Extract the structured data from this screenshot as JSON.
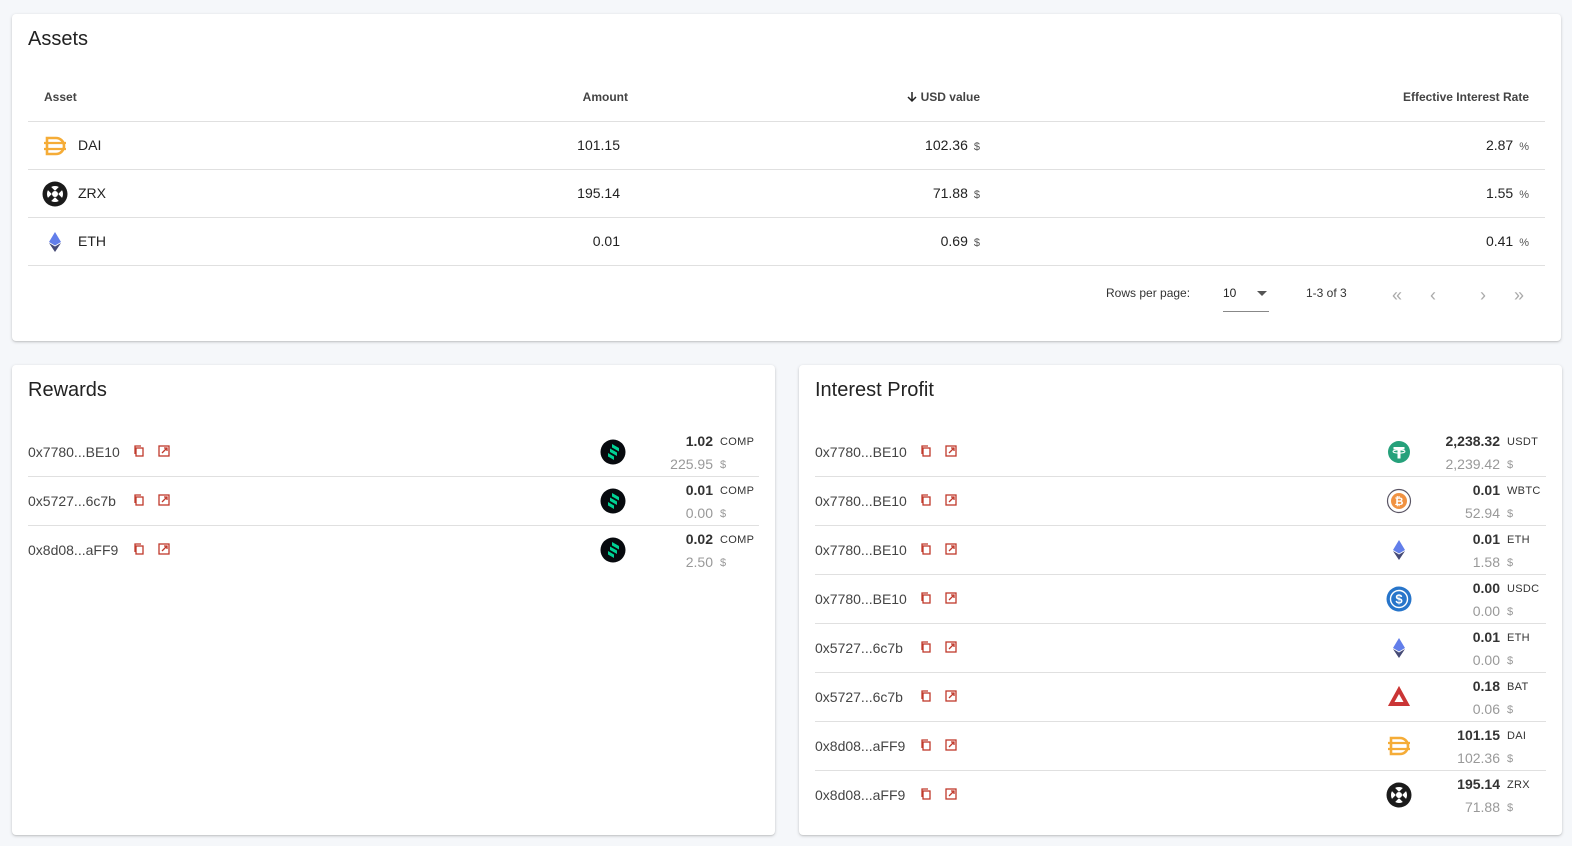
{
  "assets": {
    "title": "Assets",
    "columns": {
      "asset": "Asset",
      "amount": "Amount",
      "usd": "USD value",
      "rate": "Effective Interest Rate"
    },
    "rows": [
      {
        "name": "DAI",
        "icon": "dai-icon",
        "amount": "101.15",
        "usd": "102.36",
        "usd_unit": "$",
        "rate": "2.87",
        "rate_unit": "%"
      },
      {
        "name": "ZRX",
        "icon": "zrx-icon",
        "amount": "195.14",
        "usd": "71.88",
        "usd_unit": "$",
        "rate": "1.55",
        "rate_unit": "%"
      },
      {
        "name": "ETH",
        "icon": "eth-icon",
        "amount": "0.01",
        "usd": "0.69",
        "usd_unit": "$",
        "rate": "0.41",
        "rate_unit": "%"
      }
    ],
    "pagination": {
      "rows_per_page_label": "Rows per page:",
      "rows_per_page": "10",
      "range": "1-3 of 3"
    }
  },
  "rewards": {
    "title": "Rewards",
    "items": [
      {
        "address": "0x7780...BE10",
        "icon": "comp-icon",
        "amount": "1.02",
        "symbol": "COMP",
        "usd": "225.95",
        "usd_unit": "$"
      },
      {
        "address": "0x5727...6c7b",
        "icon": "comp-icon",
        "amount": "0.01",
        "symbol": "COMP",
        "usd": "0.00",
        "usd_unit": "$"
      },
      {
        "address": "0x8d08...aFF9",
        "icon": "comp-icon",
        "amount": "0.02",
        "symbol": "COMP",
        "usd": "2.50",
        "usd_unit": "$"
      }
    ]
  },
  "interest": {
    "title": "Interest Profit",
    "items": [
      {
        "address": "0x7780...BE10",
        "icon": "usdt-icon",
        "amount": "2,238.32",
        "symbol": "USDT",
        "usd": "2,239.42",
        "usd_unit": "$"
      },
      {
        "address": "0x7780...BE10",
        "icon": "wbtc-icon",
        "amount": "0.01",
        "symbol": "WBTC",
        "usd": "52.94",
        "usd_unit": "$"
      },
      {
        "address": "0x7780...BE10",
        "icon": "eth-icon",
        "amount": "0.01",
        "symbol": "ETH",
        "usd": "1.58",
        "usd_unit": "$"
      },
      {
        "address": "0x7780...BE10",
        "icon": "usdc-icon",
        "amount": "0.00",
        "symbol": "USDC",
        "usd": "0.00",
        "usd_unit": "$"
      },
      {
        "address": "0x5727...6c7b",
        "icon": "eth-icon",
        "amount": "0.01",
        "symbol": "ETH",
        "usd": "0.00",
        "usd_unit": "$"
      },
      {
        "address": "0x5727...6c7b",
        "icon": "bat-icon",
        "amount": "0.18",
        "symbol": "BAT",
        "usd": "0.06",
        "usd_unit": "$"
      },
      {
        "address": "0x8d08...aFF9",
        "icon": "dai-icon",
        "amount": "101.15",
        "symbol": "DAI",
        "usd": "102.36",
        "usd_unit": "$"
      },
      {
        "address": "0x8d08...aFF9",
        "icon": "zrx-icon",
        "amount": "195.14",
        "symbol": "ZRX",
        "usd": "71.88",
        "usd_unit": "$"
      }
    ]
  },
  "colors": {
    "action_icon": "#c0392b",
    "comp": "#00d395",
    "usdt": "#26a17b",
    "usdc": "#2775ca",
    "dai": "#f5ac37",
    "eth": "#627eea"
  }
}
